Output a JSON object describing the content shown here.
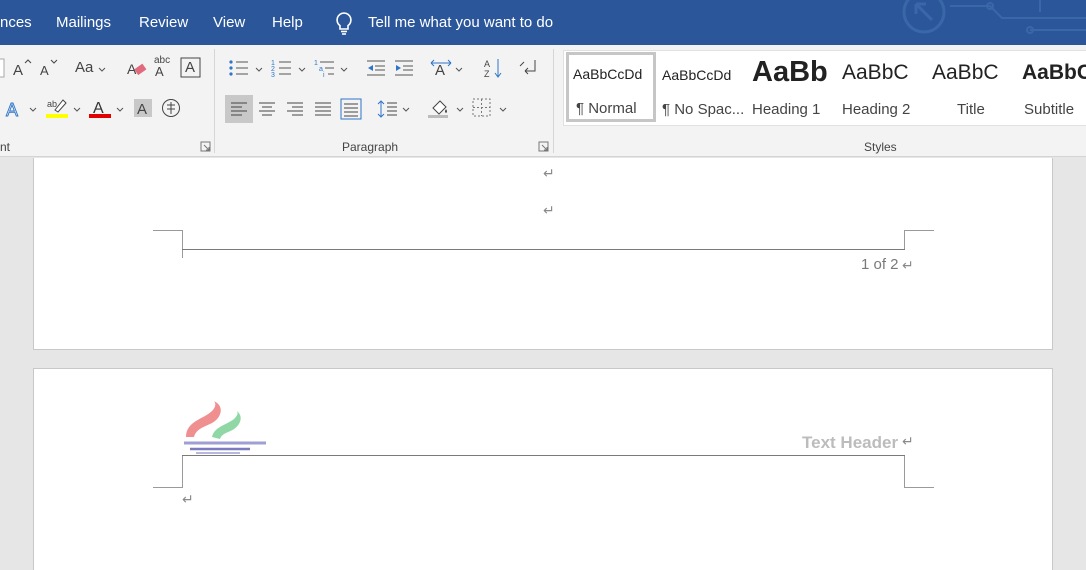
{
  "menu": {
    "tabs": [
      "nces",
      "Mailings",
      "Review",
      "View",
      "Help"
    ],
    "tell_me": "Tell me what you want to do"
  },
  "ribbon": {
    "groups": {
      "font": "nt",
      "paragraph": "Paragraph",
      "styles": "Styles"
    },
    "font_buttons": {
      "change_case": "Aa",
      "clear_formatting_letters": "abc",
      "text_box_letter": "A"
    },
    "styles": [
      {
        "sample": "AaBbCcDd",
        "name": "¶ Normal"
      },
      {
        "sample": "AaBbCcDd",
        "name": "¶ No Spac..."
      },
      {
        "sample": "AaBb",
        "name": "Heading 1"
      },
      {
        "sample": "AaBbC",
        "name": "Heading 2"
      },
      {
        "sample": "AaBbC",
        "name": "Title"
      },
      {
        "sample": "AaBbC",
        "name": "Subtitle"
      }
    ]
  },
  "document": {
    "paragraph_mark": "↵",
    "footer_page": "1 of 2",
    "header_text": "Text Header"
  },
  "colors": {
    "accent": "#2b579a",
    "highlight": "#ffff00",
    "font_color": "#ff0000"
  }
}
